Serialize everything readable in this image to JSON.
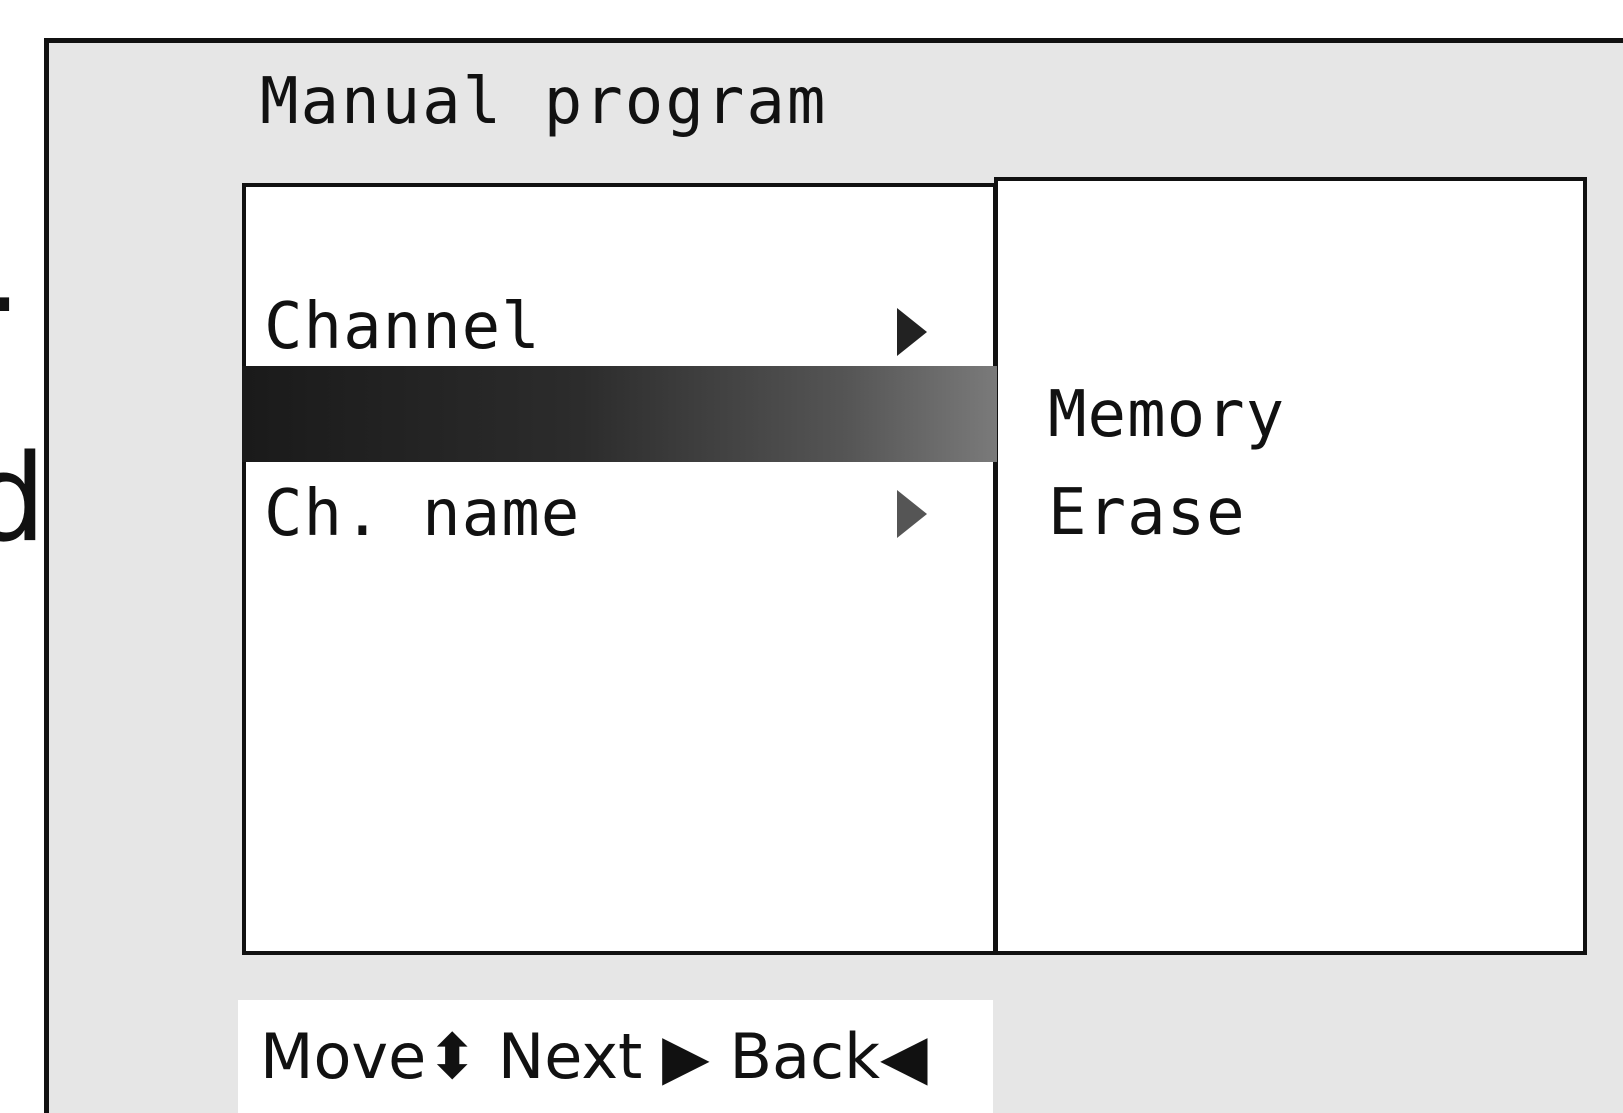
{
  "edge_text": {
    "dot": ".",
    "d": "d",
    "o": ")"
  },
  "screen": {
    "title": "Manual program"
  },
  "menu": {
    "items": [
      {
        "label": "Channel",
        "arrow": "right-arrow-icon"
      },
      {
        "label": "Ch. name",
        "arrow": "right-arrow-icon"
      }
    ],
    "highlight_index": 1
  },
  "submenu": {
    "items": [
      {
        "label": "Memory"
      },
      {
        "label": "Erase"
      }
    ]
  },
  "footer": {
    "hint": "Move⬍ Next ▶ Back◀"
  },
  "colors": {
    "frame_background": "#e6e6e6",
    "panel_background": "#ffffff",
    "text": "#111111",
    "highlight_start": "#1a1a1a",
    "highlight_end": "#7a7a7a"
  }
}
